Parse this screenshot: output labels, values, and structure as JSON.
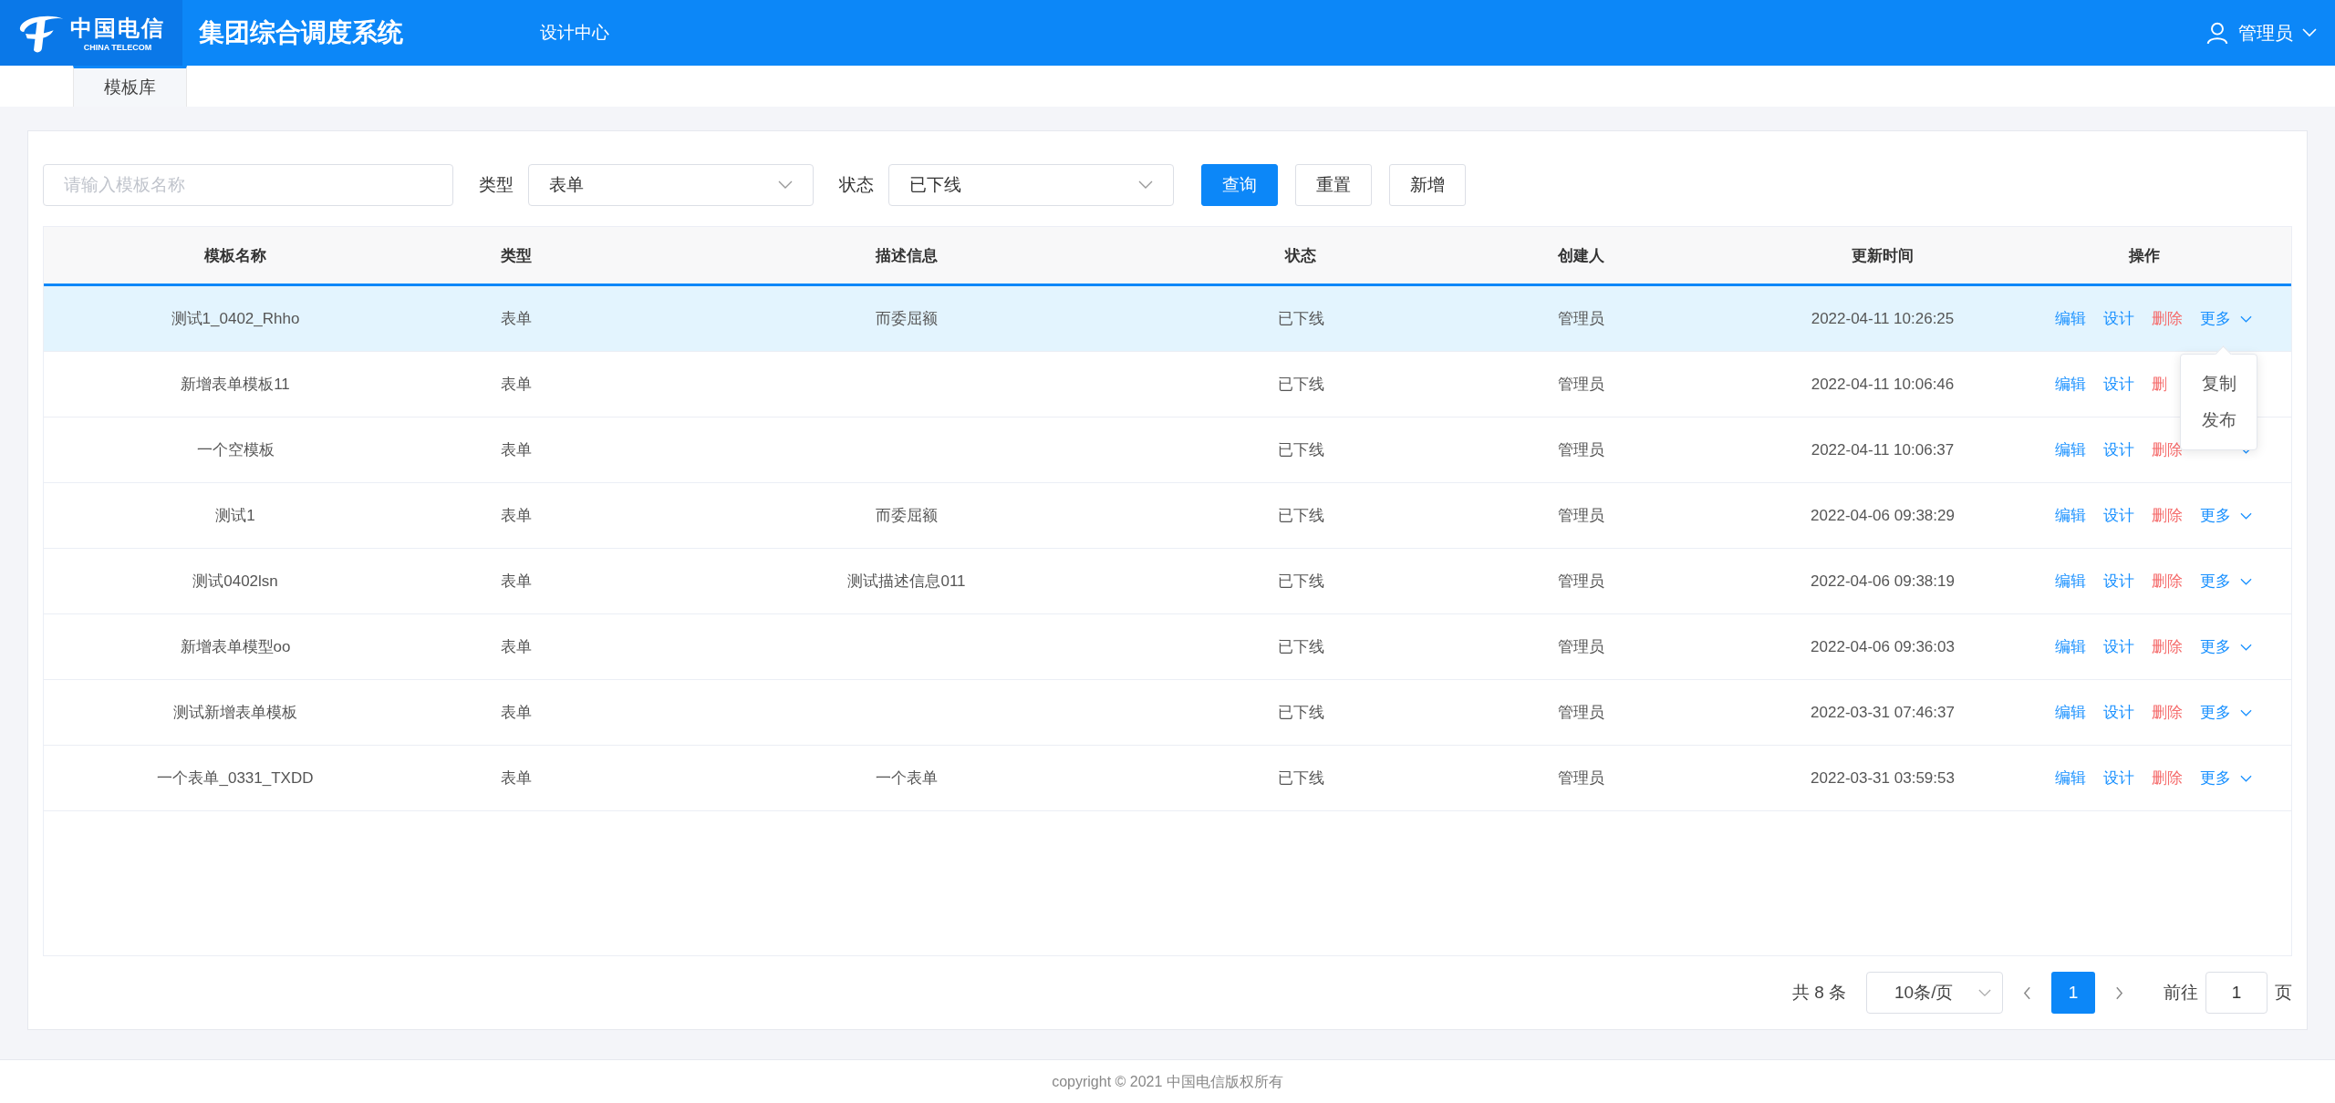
{
  "header": {
    "logo": {
      "name_cn": "中国电信",
      "name_en": "CHINA TELECOM"
    },
    "title": "集团综合调度系统",
    "nav": [
      {
        "label": "设计中心",
        "selected": true
      }
    ],
    "user": "管理员"
  },
  "tabs": [
    {
      "label": "模板库",
      "selected": true
    }
  ],
  "filters": {
    "name": {
      "placeholder": "请输入模板名称"
    },
    "type": {
      "label": "类型",
      "value": "表单"
    },
    "status": {
      "label": "状态",
      "value": "已下线"
    },
    "buttons": [
      {
        "label": "查询",
        "kind": "primary"
      },
      {
        "label": "重置",
        "kind": "default"
      },
      {
        "label": "新增",
        "kind": "default"
      }
    ]
  },
  "table": {
    "columns": [
      "模板名称",
      "类型",
      "描述信息",
      "状态",
      "创建人",
      "更新时间",
      "操作"
    ],
    "rows": [
      {
        "selected": true,
        "name": "测试1_0402_Rhho",
        "type": "表单",
        "desc": "而委屈额",
        "status": "已下线",
        "creator": "管理员",
        "updated": "2022-04-11 10:26:25",
        "actions": [
          {
            "label": "编辑",
            "kind": "link"
          },
          {
            "label": "设计",
            "kind": "link"
          },
          {
            "label": "删除",
            "kind": "danger"
          },
          {
            "label": "更多",
            "kind": "more"
          }
        ]
      },
      {
        "selected": false,
        "name": "新增表单模板11",
        "type": "表单",
        "status": "已下线",
        "creator": "管理员",
        "updated": "2022-04-11 10:06:46",
        "actions": [
          {
            "label": "编辑",
            "kind": "link"
          },
          {
            "label": "设计",
            "kind": "link"
          },
          {
            "label": "删",
            "kind": "danger"
          }
        ]
      },
      {
        "selected": false,
        "name": "一个空模板",
        "type": "表单",
        "status": "已下线",
        "creator": "管理员",
        "updated": "2022-04-11 10:06:37",
        "actions": [
          {
            "label": "编辑",
            "kind": "link"
          },
          {
            "label": "设计",
            "kind": "link"
          },
          {
            "label": "删除",
            "kind": "danger"
          },
          {
            "kind": "more"
          }
        ]
      },
      {
        "selected": false,
        "name": "测试1",
        "type": "表单",
        "desc": "而委屈额",
        "status": "已下线",
        "creator": "管理员",
        "updated": "2022-04-06 09:38:29",
        "actions": [
          {
            "label": "编辑",
            "kind": "link"
          },
          {
            "label": "设计",
            "kind": "link"
          },
          {
            "label": "删除",
            "kind": "danger"
          },
          {
            "label": "更多",
            "kind": "more"
          }
        ]
      },
      {
        "selected": false,
        "name": "测试0402lsn",
        "type": "表单",
        "desc": "测试描述信息011",
        "status": "已下线",
        "creator": "管理员",
        "updated": "2022-04-06 09:38:19",
        "actions": [
          {
            "label": "编辑",
            "kind": "link"
          },
          {
            "label": "设计",
            "kind": "link"
          },
          {
            "label": "删除",
            "kind": "danger"
          },
          {
            "label": "更多",
            "kind": "more"
          }
        ]
      },
      {
        "selected": false,
        "name": "新增表单模型oo",
        "type": "表单",
        "status": "已下线",
        "creator": "管理员",
        "updated": "2022-04-06 09:36:03",
        "actions": [
          {
            "label": "编辑",
            "kind": "link"
          },
          {
            "label": "设计",
            "kind": "link"
          },
          {
            "label": "删除",
            "kind": "danger"
          },
          {
            "label": "更多",
            "kind": "more"
          }
        ]
      },
      {
        "selected": false,
        "name": "测试新增表单模板",
        "type": "表单",
        "status": "已下线",
        "creator": "管理员",
        "updated": "2022-03-31 07:46:37",
        "actions": [
          {
            "label": "编辑",
            "kind": "link"
          },
          {
            "label": "设计",
            "kind": "link"
          },
          {
            "label": "删除",
            "kind": "danger"
          },
          {
            "label": "更多",
            "kind": "more"
          }
        ]
      },
      {
        "selected": false,
        "name": "一个表单_0331_TXDD",
        "type": "表单",
        "desc": "一个表单",
        "status": "已下线",
        "creator": "管理员",
        "updated": "2022-03-31 03:59:53",
        "actions": [
          {
            "label": "编辑",
            "kind": "link"
          },
          {
            "label": "设计",
            "kind": "link"
          },
          {
            "label": "删除",
            "kind": "danger"
          },
          {
            "label": "更多",
            "kind": "more"
          }
        ]
      }
    ],
    "dropdown": {
      "items": [
        "复制",
        "发布"
      ]
    }
  },
  "pagination": {
    "total": "共 8 条",
    "page_size": "10条/页",
    "pages": [
      {
        "label": "1",
        "selected": true
      }
    ],
    "goto_label": "前往",
    "goto_value": "1",
    "goto_suffix": "页"
  },
  "footer": "copyright © 2021 中国电信版权所有"
}
